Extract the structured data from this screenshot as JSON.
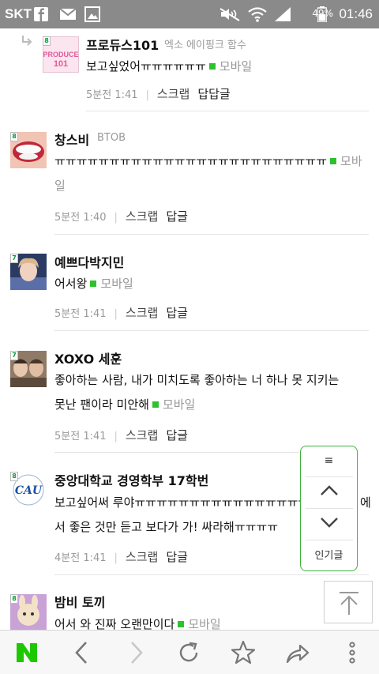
{
  "status_bar": {
    "carrier": "SKT",
    "battery": "49%",
    "time": "01:46"
  },
  "comments": [
    {
      "name": "프로듀스101",
      "tag": "엑소 에이핑크 함수",
      "text": "보고싶었어ㅠㅠㅠㅠㅠㅠ",
      "mobile": "모바일",
      "time": "5분전 1:41",
      "scrap": "스크랩",
      "reply": "답답글"
    },
    {
      "name": "창스비",
      "tag": "BTOB",
      "text": "ㅠㅠㅠㅠㅠㅠㅠㅠㅠㅠㅠㅠㅠㅠㅠㅠㅠㅠㅠㅠㅠㅠㅠㅠㅠ",
      "mobile_a": "모바",
      "mobile_b": "일",
      "time": "5분전 1:40",
      "scrap": "스크랩",
      "reply": "답글"
    },
    {
      "name": "예쁘다박지민",
      "text": "어서왕",
      "mobile": "모바일",
      "time": "5분전 1:41",
      "scrap": "스크랩",
      "reply": "답글"
    },
    {
      "name": "XOXO 세훈",
      "text_line1": "좋아하는 사람, 내가 미치도록 좋아하는 너 하나 못 지키는",
      "text_line2": "못난 팬이라 미안해",
      "mobile": "모바일",
      "time": "5분전 1:41",
      "scrap": "스크랩",
      "reply": "답글"
    },
    {
      "name": "중앙대학교 경영학부 17학번",
      "text_line1": "보고싶어써 루야ㅠㅠㅠㅠㅠㅠㅠㅠㅠㅠㅠㅠㅠㅠㅠㅠ",
      "text_line1_end": "에",
      "text_line2": "서 좋은 것만 듣고 보다가 가! 싸라해ㅠㅠㅠㅠ",
      "time": "4분전 1:41",
      "scrap": "스크랩",
      "reply": "답글"
    },
    {
      "name": "밤비 토끼",
      "text": "어서 와 진짜 오랜만이다",
      "mobile": "모바일"
    }
  ],
  "float_nav": {
    "menu_icon": "≡",
    "popular_label": "인기글"
  },
  "avatar_badges": [
    "8",
    "8",
    "7",
    "7",
    "8",
    "8"
  ],
  "colors": {
    "accent": "#2ec12e",
    "naver_green": "#1ec800"
  }
}
